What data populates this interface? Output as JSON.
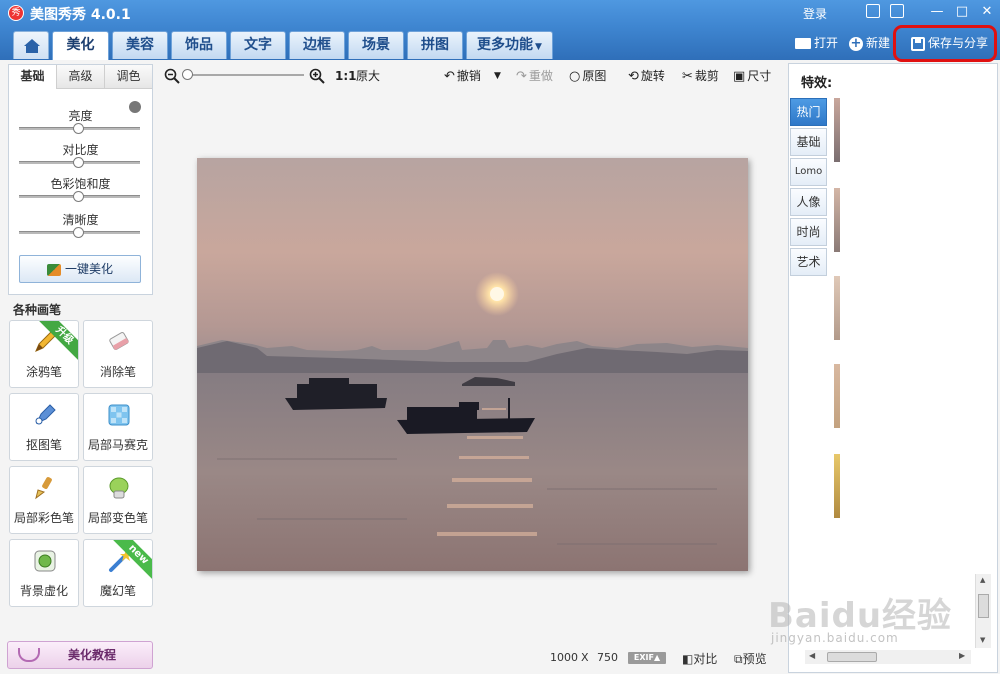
{
  "titlebar": {
    "app_logo": "秀",
    "app_title": "美图秀秀 4.0.1",
    "login": "登录",
    "minimize": "—",
    "maximize": "□",
    "close": "✕"
  },
  "nav": {
    "tabs": [
      {
        "label": "美化",
        "active": true
      },
      {
        "label": "美容"
      },
      {
        "label": "饰品"
      },
      {
        "label": "文字"
      },
      {
        "label": "边框"
      },
      {
        "label": "场景"
      },
      {
        "label": "拼图"
      },
      {
        "label": "更多功能"
      }
    ],
    "open_label": "打开",
    "new_label": "新建",
    "save_share_label": "保存与分享"
  },
  "left_panel": {
    "sub_tabs": [
      "基础",
      "高级",
      "调色"
    ],
    "sliders": [
      {
        "label": "亮度",
        "value": 0.5
      },
      {
        "label": "对比度",
        "value": 0.5
      },
      {
        "label": "色彩饱和度",
        "value": 0.5
      },
      {
        "label": "清晰度",
        "value": 0.5
      }
    ],
    "one_key_label": "一键美化",
    "brushes_title": "各种画笔",
    "brushes": [
      {
        "label": "涂鸦笔",
        "icon": "pencil-icon",
        "ribbon": "升级"
      },
      {
        "label": "消除笔",
        "icon": "eraser-icon"
      },
      {
        "label": "抠图笔",
        "icon": "cutout-pen-icon"
      },
      {
        "label": "局部马赛克",
        "icon": "mosaic-icon"
      },
      {
        "label": "局部彩色笔",
        "icon": "color-brush-icon"
      },
      {
        "label": "局部变色笔",
        "icon": "paint-bucket-icon"
      },
      {
        "label": "背景虚化",
        "icon": "blur-icon"
      },
      {
        "label": "魔幻笔",
        "icon": "magic-wand-icon",
        "ribbon": "new"
      }
    ],
    "tutorial_label": "美化教程"
  },
  "canvas_toolbar": {
    "ratio_label": "1:1",
    "original_size_label": "原大",
    "undo_label": "撤销",
    "redo_label": "重做",
    "original_label": "原图",
    "rotate_label": "旋转",
    "crop_label": "裁剪",
    "size_label": "尺寸"
  },
  "status": {
    "width": "1000",
    "times": "X",
    "height": "750",
    "exif": "EXIF",
    "compare_label": "对比",
    "preview_label": "预览"
  },
  "right_panel": {
    "title": "特效:",
    "categories": [
      "热门",
      "基础",
      "Lomo",
      "人像",
      "时尚",
      "艺术"
    ],
    "active_category": "热门"
  },
  "watermark": {
    "brand": "Baidu经验",
    "url": "jingyan.baidu.com"
  },
  "colors": {
    "titlebar": "#4f98e0",
    "annotation": "#e01010",
    "accent": "#2f78c8"
  }
}
